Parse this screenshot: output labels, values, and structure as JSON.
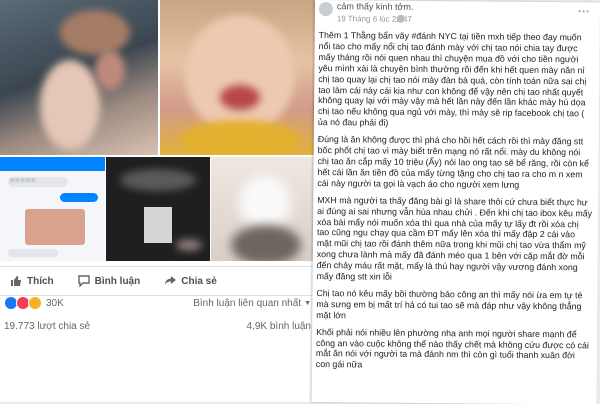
{
  "share_row": {
    "like_label": "Thích",
    "comment_label": "Bình luận",
    "share_label": "Chia sẻ"
  },
  "reactions": {
    "count": "30K",
    "comment_sort": "Bình luận liên quan nhất",
    "share_count": "19.773 lượt chia sẻ",
    "comment_count": "4,9K bình luận"
  },
  "post": {
    "header_label": "cảm thấy kinh tởm.",
    "timestamp": "19 Tháng 6 lúc 22:47",
    "paragraphs": [
      "Thêm 1 Thằng bẩn vãy #đánh NYC tại tiền mxh tiếp theo đạy muốn nổi tao cho mấy nổi chị tao đánh mày với chị tao nói chia tay được mấy tháng rồi nói quen nhau thì chuyện mua đồ với cho tiền người yêu mình xài là chuyện bình thường rồi đến khi hết quen mày năn nỉ chị tao quay lại chị tao nói mày đàn bà quá, còn tính toán nữa sai chị tao làm cái này cái kia như con không để vậy nên chị tao nhất quyết không quay lại với mày vậy mà hết lần này đến lần khác mày hù dọa chị tao nếu không qua ngủ với mày, thì mày sẽ rip facebook chị tao ( ủa nó đau phải đi)",
      "Đúng là ăn không được thì phá cho hồi hết cách rồi thì mày đăng stt bốc phốt chị tao vì mày biết trên mạng nó rất nổi. mày du không nói chị tao ăn cắp mấy 10 triệu (Ấy) nói lao ong tao sẽ bể răng, rồi còn kể hết cái lần ăn tiền đồ của mấy từng tặng cho chị tao ra cho m n xem cái này người ta gọi là vạch áo cho người xem lưng",
      "MXH mà người ta thấy đăng bài gì là share thôi cứ chưa biết thực hư ai đúng ai sai nhưng vẫn hùa nhau chửi . Đến khi chị tao ibox kêu mấy xóa bài mấy nói muốn xóa thì qua nhà của mấy tự lấy đt rồi xóa chị tao cũng ngu chạy qua cầm ĐT mấy lên xóa thì mấy đập 2 cái vào mặt mũi chị tao rồi đánh thêm nữa trong khi mũi chị tao vừa thẩm mỹ xong chưa lành mà mấy đã đánh méo qua 1 bên với cặp mắt đờ mỗi đến chảy máu rất mặt, mấy là thú hay người vậy vương đánh xong mấy đăng stt xin lỗi",
      "Chị tao nó kêu mấy bồi thường báo công an thì mấy nói ừa em tự té mà sưng em bị mất trí hả có tui tao sẽ mà đáp như vậy không thẳng mặt lớn",
      "Khối phải nói nhiều lên phường nha anh mọi người share mạnh để công an vào cuộc không thể nào thấy chết mà không cứu được có cái mắt ăn nói với người ta mà đánh nm thì còn gì tuổi thanh xuân đời con gái nữa"
    ]
  },
  "chat": {
    "blurred_name": "●●●●●"
  },
  "colors": {
    "fb_blue": "#4267b2",
    "messenger_blue": "#0084ff",
    "text_gray": "#616770",
    "like_blue": "#1877f2",
    "love_red": "#f33e58",
    "haha_yellow": "#f7b125"
  },
  "icons": [
    "like-icon",
    "comment-icon",
    "share-icon",
    "like-reaction-icon",
    "love-reaction-icon",
    "haha-reaction-icon",
    "dropdown-icon"
  ]
}
